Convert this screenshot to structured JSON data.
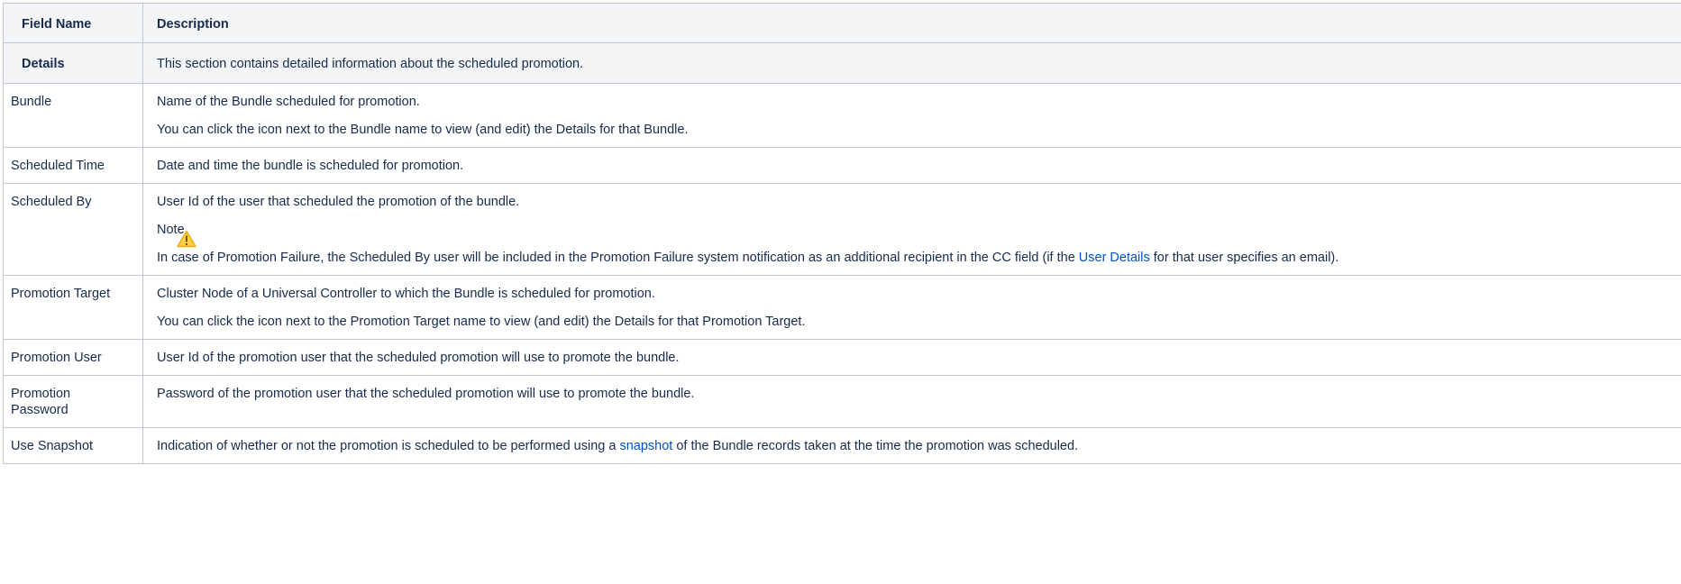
{
  "headers": {
    "field_name": "Field Name",
    "description": "Description"
  },
  "section": {
    "name": "Details",
    "description": "This section contains detailed information about the scheduled promotion."
  },
  "rows": {
    "bundle": {
      "name": "Bundle",
      "p1": "Name of the Bundle scheduled for promotion.",
      "p2": "You can click the icon next to the Bundle name to view (and edit) the Details for that Bundle."
    },
    "scheduled_time": {
      "name": "Scheduled Time",
      "p1": "Date and time the bundle is scheduled for promotion."
    },
    "scheduled_by": {
      "name": "Scheduled By",
      "p1": "User Id of the user that scheduled the promotion of the bundle.",
      "note_title": "Note",
      "note_before": "In case of Promotion Failure, the Scheduled By user will be included in the Promotion Failure system notification as an additional recipient in the CC field (if the ",
      "note_link": "User Details",
      "note_after": " for that user specifies an email).",
      "note_icon": "warning-icon"
    },
    "promotion_target": {
      "name": "Promotion Target",
      "p1": "Cluster Node of a Universal Controller to which the Bundle is scheduled for promotion.",
      "p2": "You can click the icon next to the Promotion Target name to view (and edit) the Details for that Promotion Target."
    },
    "promotion_user": {
      "name": "Promotion User",
      "p1": "User Id of the promotion user that the scheduled promotion will use to promote the bundle."
    },
    "promotion_password": {
      "name": "Promotion Password",
      "p1": "Password of the promotion user that the scheduled promotion will use to promote the bundle."
    },
    "use_snapshot": {
      "name": "Use Snapshot",
      "before": "Indication of whether or not the promotion is scheduled to be performed using a ",
      "link": "snapshot",
      "after": " of the Bundle records taken at the time the promotion was scheduled."
    }
  },
  "colors": {
    "border": "#c1c7d0",
    "header_bg": "#f4f5f7",
    "link": "#0052cc",
    "text": "#172b4d",
    "warning": "#ffab00"
  }
}
